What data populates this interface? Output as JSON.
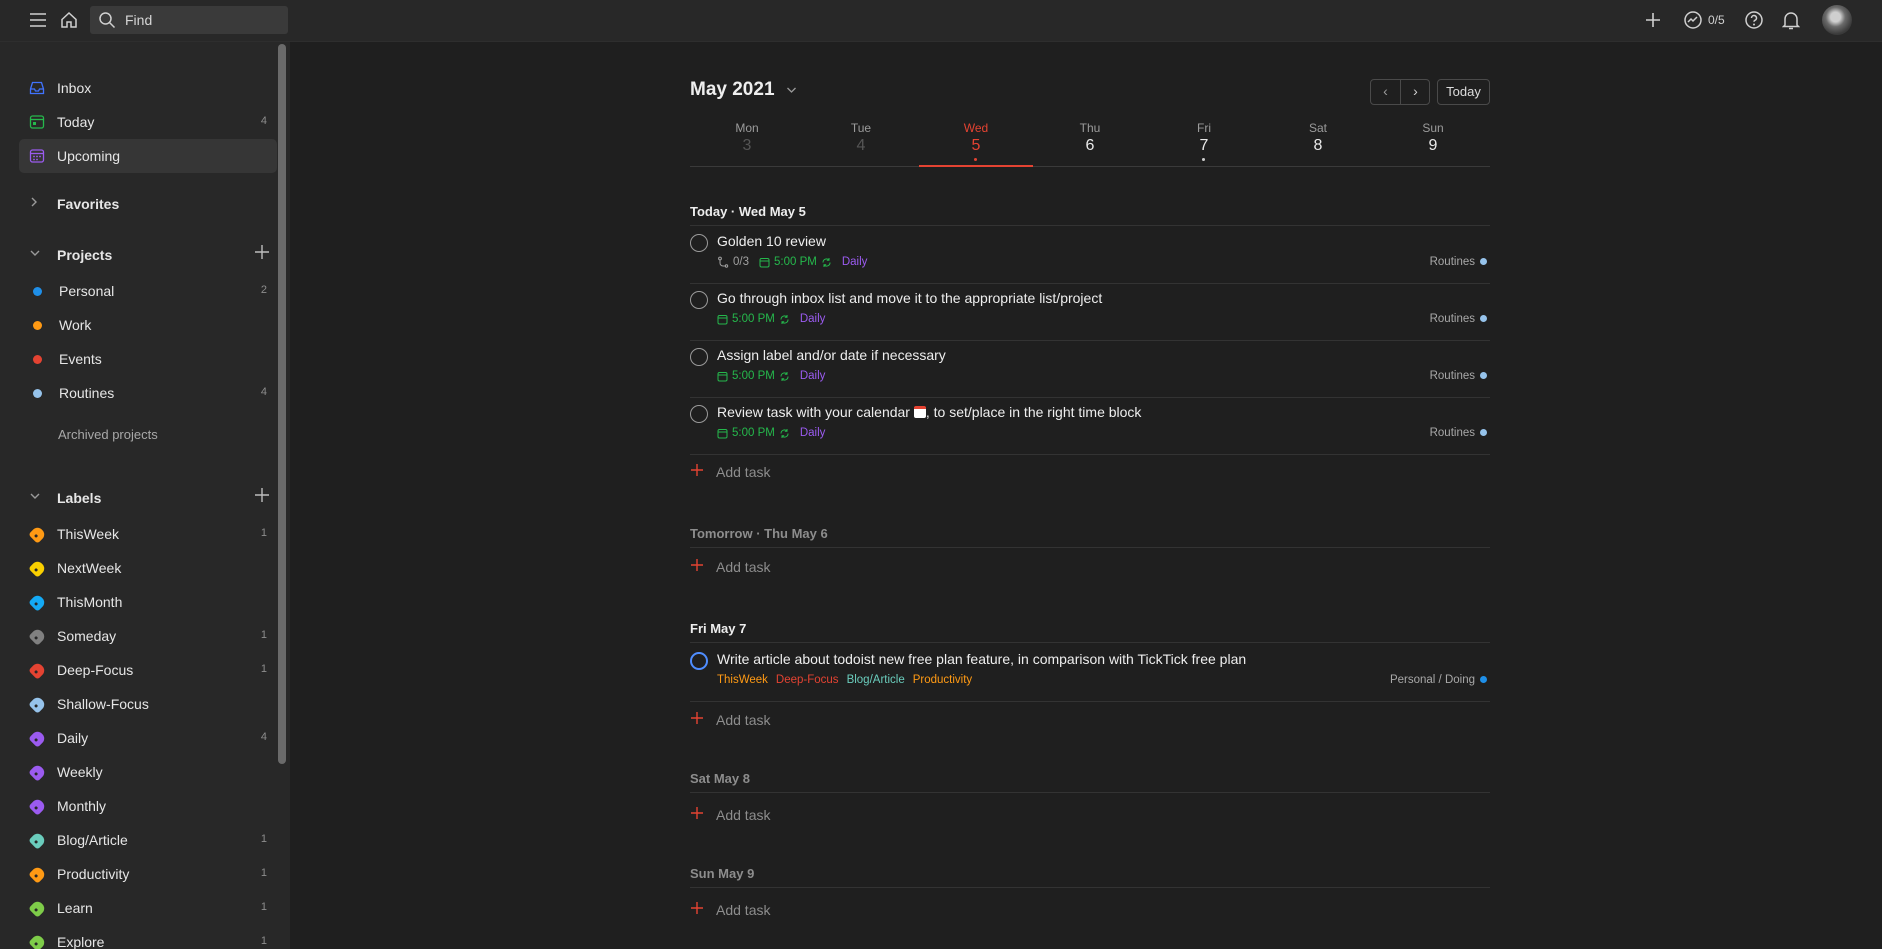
{
  "topbar": {
    "search_placeholder": "Find",
    "karma": "0/5"
  },
  "sidebar": {
    "nav": [
      {
        "label": "Inbox",
        "count": "",
        "color": "#4073ff"
      },
      {
        "label": "Today",
        "count": "4",
        "color": "#25b84c"
      },
      {
        "label": "Upcoming",
        "count": "",
        "color": "#9b5bf0"
      }
    ],
    "favorites_title": "Favorites",
    "projects_title": "Projects",
    "projects": [
      {
        "label": "Personal",
        "count": "2",
        "color": "#1f8fe8"
      },
      {
        "label": "Work",
        "count": "",
        "color": "#ff9a14"
      },
      {
        "label": "Events",
        "count": "",
        "color": "#e44332"
      },
      {
        "label": "Routines",
        "count": "4",
        "color": "#96c3eb"
      }
    ],
    "archived_label": "Archived projects",
    "labels_title": "Labels",
    "labels": [
      {
        "label": "ThisWeek",
        "count": "1",
        "color": "#ff9a14"
      },
      {
        "label": "NextWeek",
        "count": "",
        "color": "#fad000"
      },
      {
        "label": "ThisMonth",
        "count": "",
        "color": "#14aaf5"
      },
      {
        "label": "Someday",
        "count": "1",
        "color": "#808080"
      },
      {
        "label": "Deep-Focus",
        "count": "1",
        "color": "#e44332"
      },
      {
        "label": "Shallow-Focus",
        "count": "",
        "color": "#96c3eb"
      },
      {
        "label": "Daily",
        "count": "4",
        "color": "#9b5bf0"
      },
      {
        "label": "Weekly",
        "count": "",
        "color": "#9b5bf0"
      },
      {
        "label": "Monthly",
        "count": "",
        "color": "#9b5bf0"
      },
      {
        "label": "Blog/Article",
        "count": "1",
        "color": "#6accbc"
      },
      {
        "label": "Productivity",
        "count": "1",
        "color": "#ff9a14"
      },
      {
        "label": "Learn",
        "count": "1",
        "color": "#7ecc49"
      },
      {
        "label": "Explore",
        "count": "1",
        "color": "#7ecc49"
      }
    ]
  },
  "calendar": {
    "month": "May 2021",
    "today_button": "Today",
    "days": [
      {
        "name": "Mon",
        "num": "3"
      },
      {
        "name": "Tue",
        "num": "4"
      },
      {
        "name": "Wed",
        "num": "5"
      },
      {
        "name": "Thu",
        "num": "6"
      },
      {
        "name": "Fri",
        "num": "7"
      },
      {
        "name": "Sat",
        "num": "8"
      },
      {
        "name": "Sun",
        "num": "9"
      }
    ]
  },
  "sections": {
    "today": "Today · Wed May 5",
    "tomorrow": "Tomorrow · Thu May 6",
    "fri": "Fri May 7",
    "sat": "Sat May 8",
    "sun": "Sun May 9"
  },
  "add_task": "Add task",
  "tasks_today": [
    {
      "title": "Golden 10 review",
      "subtasks": "0/3",
      "due": "5:00 PM",
      "label": "Daily",
      "project": "Routines"
    },
    {
      "title": "Go through inbox list and move it to the appropriate list/project",
      "due": "5:00 PM",
      "label": "Daily",
      "project": "Routines"
    },
    {
      "title": "Assign label and/or date if necessary",
      "due": "5:00 PM",
      "label": "Daily",
      "project": "Routines"
    },
    {
      "title_before": "Review task with your calendar",
      "title_after": ", to set/place in the right time block",
      "due": "5:00 PM",
      "label": "Daily",
      "project": "Routines"
    }
  ],
  "task_fri": {
    "title": "Write article about todoist new free plan feature, in comparison with TickTick free plan",
    "labels": [
      {
        "text": "ThisWeek",
        "color": "#ff9a14"
      },
      {
        "text": "Deep-Focus",
        "color": "#e44332"
      },
      {
        "text": "Blog/Article",
        "color": "#6accbc"
      },
      {
        "text": "Productivity",
        "color": "#ff9a14"
      }
    ],
    "project": "Personal / Doing"
  }
}
